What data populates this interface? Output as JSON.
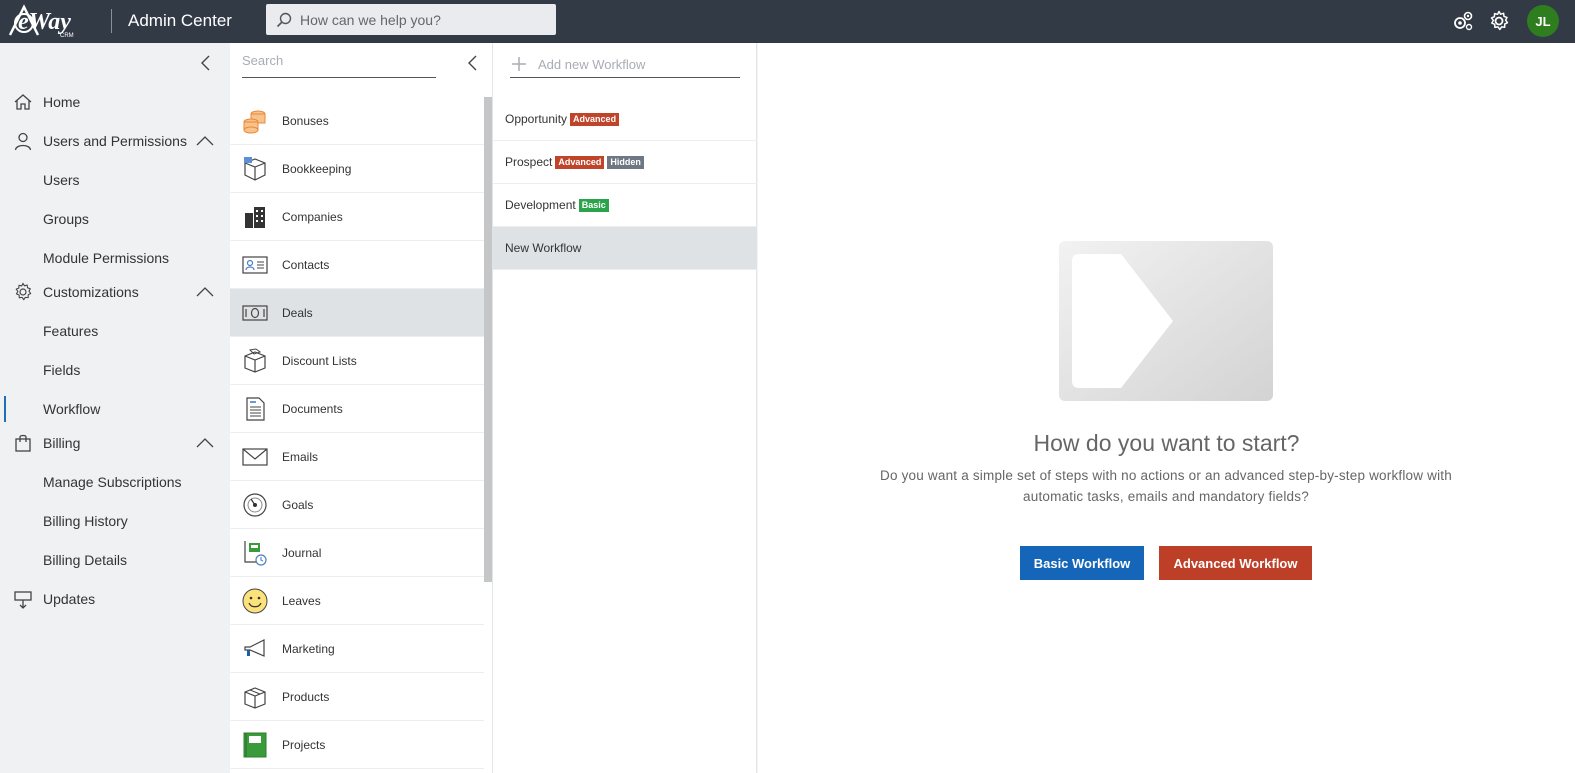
{
  "header": {
    "logo_text": "eWay",
    "logo_sub": "CRM",
    "title": "Admin Center",
    "search_placeholder": "How can we help you?",
    "avatar_initials": "JL",
    "icons": [
      "extensions-icon",
      "settings-icon"
    ]
  },
  "sidebar": {
    "items": [
      {
        "label": "Home",
        "icon": "home-icon",
        "level": 0
      },
      {
        "label": "Users and Permissions",
        "icon": "user-icon",
        "level": 0,
        "expanded": true
      },
      {
        "label": "Users",
        "level": 1
      },
      {
        "label": "Groups",
        "level": 1
      },
      {
        "label": "Module Permissions",
        "level": 1
      },
      {
        "label": "Customizations",
        "icon": "gear-icon",
        "level": 0,
        "expanded": true
      },
      {
        "label": "Features",
        "level": 1
      },
      {
        "label": "Fields",
        "level": 1
      },
      {
        "label": "Workflow",
        "level": 1,
        "active": true
      },
      {
        "label": "Billing",
        "icon": "bag-icon",
        "level": 0,
        "expanded": true
      },
      {
        "label": "Manage Subscriptions",
        "level": 1
      },
      {
        "label": "Billing History",
        "level": 1
      },
      {
        "label": "Billing Details",
        "level": 1
      },
      {
        "label": "Updates",
        "icon": "updates-icon",
        "level": 0
      }
    ]
  },
  "modules": {
    "search_placeholder": "Search",
    "items": [
      {
        "label": "Bonuses",
        "icon": "coins-icon"
      },
      {
        "label": "Bookkeeping",
        "icon": "box-icon"
      },
      {
        "label": "Companies",
        "icon": "building-icon"
      },
      {
        "label": "Contacts",
        "icon": "contact-card-icon"
      },
      {
        "label": "Deals",
        "icon": "deal-icon",
        "selected": true
      },
      {
        "label": "Discount Lists",
        "icon": "discount-box-icon"
      },
      {
        "label": "Documents",
        "icon": "document-icon"
      },
      {
        "label": "Emails",
        "icon": "envelope-icon"
      },
      {
        "label": "Goals",
        "icon": "target-icon"
      },
      {
        "label": "Journal",
        "icon": "journal-icon"
      },
      {
        "label": "Leaves",
        "icon": "smiley-icon"
      },
      {
        "label": "Marketing",
        "icon": "megaphone-icon"
      },
      {
        "label": "Products",
        "icon": "product-box-icon"
      },
      {
        "label": "Projects",
        "icon": "project-icon"
      }
    ]
  },
  "workflows": {
    "add_label": "Add new Workflow",
    "items": [
      {
        "label": "Opportunity",
        "badges": [
          {
            "text": "Advanced",
            "type": "adv"
          }
        ]
      },
      {
        "label": "Prospect",
        "badges": [
          {
            "text": "Advanced",
            "type": "adv"
          },
          {
            "text": "Hidden",
            "type": "hid"
          }
        ]
      },
      {
        "label": "Development",
        "badges": [
          {
            "text": "Basic",
            "type": "bas"
          }
        ]
      },
      {
        "label": "New Workflow",
        "badges": [],
        "selected": true
      }
    ]
  },
  "main": {
    "title": "How do you want to start?",
    "description_line1": "Do you want a simple set of steps with no actions or an advanced step-by-step workflow with",
    "description_line2": "automatic tasks, emails and mandatory fields?",
    "basic_button": "Basic Workflow",
    "advanced_button": "Advanced Workflow"
  },
  "colors": {
    "topbar": "#323a45",
    "basic": "#1565b8",
    "advanced": "#bd3f27",
    "hidden": "#6e7883",
    "basic_badge": "#2aa34a",
    "avatar": "#2e7d1f"
  }
}
